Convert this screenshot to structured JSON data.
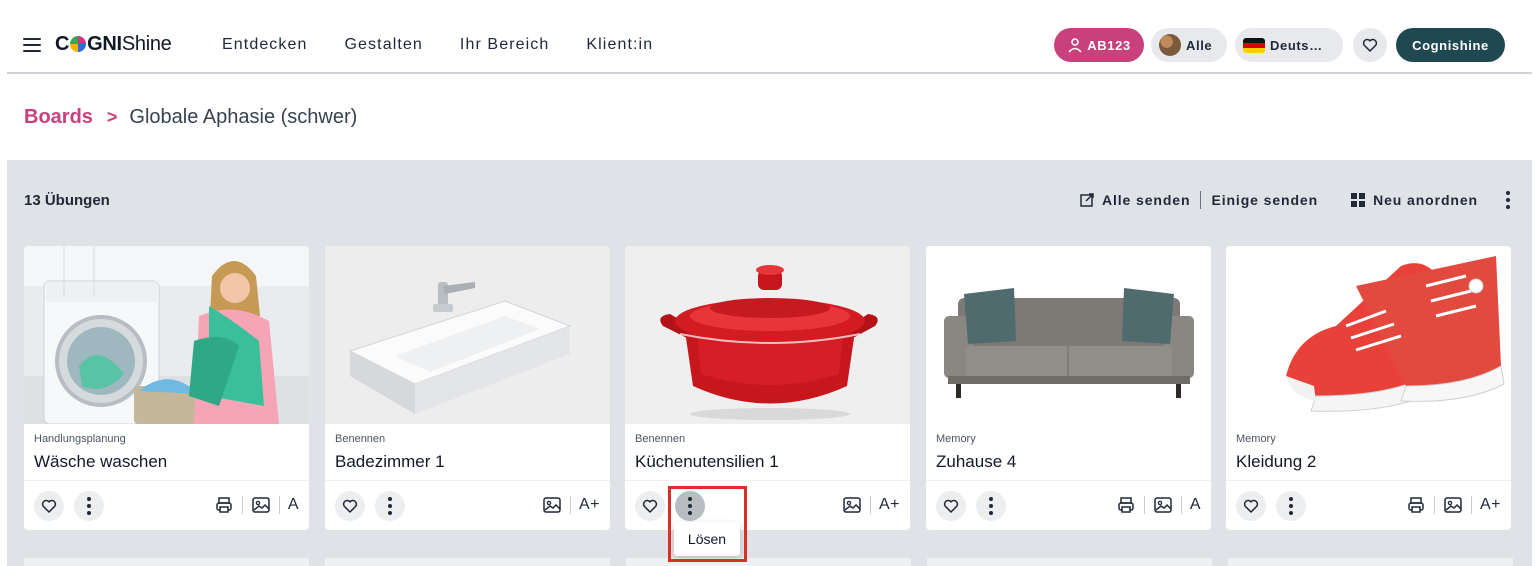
{
  "header": {
    "logo": {
      "prefix": "C",
      "mid": "GNI",
      "suffix": "Shine"
    },
    "nav": [
      "Entdecken",
      "Gestalten",
      "Ihr Bereich",
      "Klient:in"
    ],
    "user_code": "AB123",
    "filter_label": "Alle",
    "language_label": "Deuts…",
    "account_label": "Cognishine"
  },
  "breadcrumb": {
    "root": "Boards",
    "separator": ">",
    "current": "Globale Aphasie (schwer)"
  },
  "board": {
    "count_label": "13 Übungen",
    "send_all": "Alle senden",
    "send_some": "Einige senden",
    "reorder": "Neu anordnen"
  },
  "cards": [
    {
      "category": "Handlungsplanung",
      "title": "Wäsche waschen",
      "image": "laundry-photo",
      "print": true,
      "font": "A"
    },
    {
      "category": "Benennen",
      "title": "Badezimmer 1",
      "image": "sink-photo",
      "print": false,
      "font": "A+"
    },
    {
      "category": "Benennen",
      "title": "Küchenutensilien 1",
      "image": "pot-photo",
      "print": false,
      "font": "A+"
    },
    {
      "category": "Memory",
      "title": "Zuhause 4",
      "image": "sofa-photo",
      "print": true,
      "font": "A"
    },
    {
      "category": "Memory",
      "title": "Kleidung 2",
      "image": "sneakers-photo",
      "print": true,
      "font": "A+"
    }
  ],
  "popup": {
    "label": "Lösen"
  },
  "colors": {
    "brand_pink": "#c9417c",
    "account_teal": "#1f4850",
    "panel_bg": "#dfe2e6",
    "highlight_red": "#d93025"
  }
}
